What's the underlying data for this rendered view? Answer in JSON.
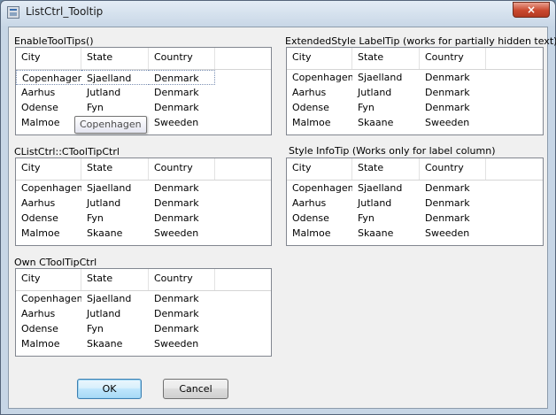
{
  "window": {
    "title": "ListCtrl_Tooltip",
    "close_glyph": "×"
  },
  "columns": [
    "City",
    "State",
    "Country"
  ],
  "rows": [
    [
      "Copenhagen",
      "Sjaelland",
      "Denmark"
    ],
    [
      "Aarhus",
      "Jutland",
      "Denmark"
    ],
    [
      "Odense",
      "Fyn",
      "Denmark"
    ],
    [
      "Malmoe",
      "Skaane",
      "Sweeden"
    ]
  ],
  "groups": [
    {
      "label": "EnableToolTips()"
    },
    {
      "label": "CListCtrl::CToolTipCtrl"
    },
    {
      "label": "Own CToolTipCtrl"
    },
    {
      "label": "ExtendedStyle LabelTip (works for partially hidden text)"
    },
    {
      "label": "Style InfoTip (Works only for label column)"
    }
  ],
  "tooltip": {
    "text": "Copenhagen"
  },
  "buttons": {
    "ok": "OK",
    "cancel": "Cancel"
  },
  "icons": {
    "app": "app-icon",
    "close": "close-icon"
  },
  "colors": {
    "titlebar": "#c7d6e6",
    "close": "#c9482e",
    "client": "#f0f0f0"
  }
}
